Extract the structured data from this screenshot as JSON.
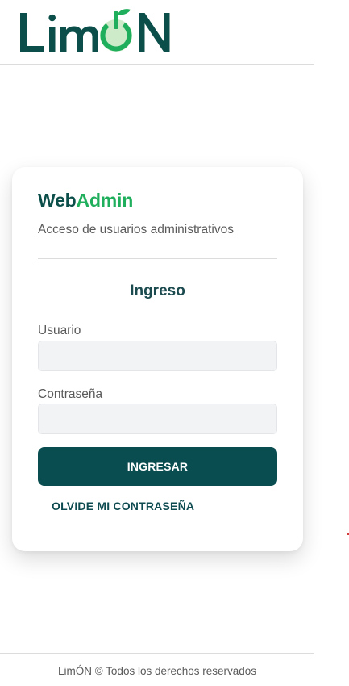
{
  "header": {
    "logo_text": "LimÓN",
    "colors": {
      "dark": "#0c4f4a",
      "green": "#1fae5b",
      "light_green": "#cdebc9"
    }
  },
  "card": {
    "brand_part1": "Web",
    "brand_part2": "Admin",
    "subtitle": "Acceso de usuarios administrativos",
    "section_title": "Ingreso",
    "username_label": "Usuario",
    "username_value": "",
    "password_label": "Contraseña",
    "password_value": "",
    "login_button": "INGRESAR",
    "forgot_link": "OLVIDE MI CONTRASEÑA"
  },
  "footer": {
    "text": "LimÓN © Todos los derechos reservados"
  }
}
